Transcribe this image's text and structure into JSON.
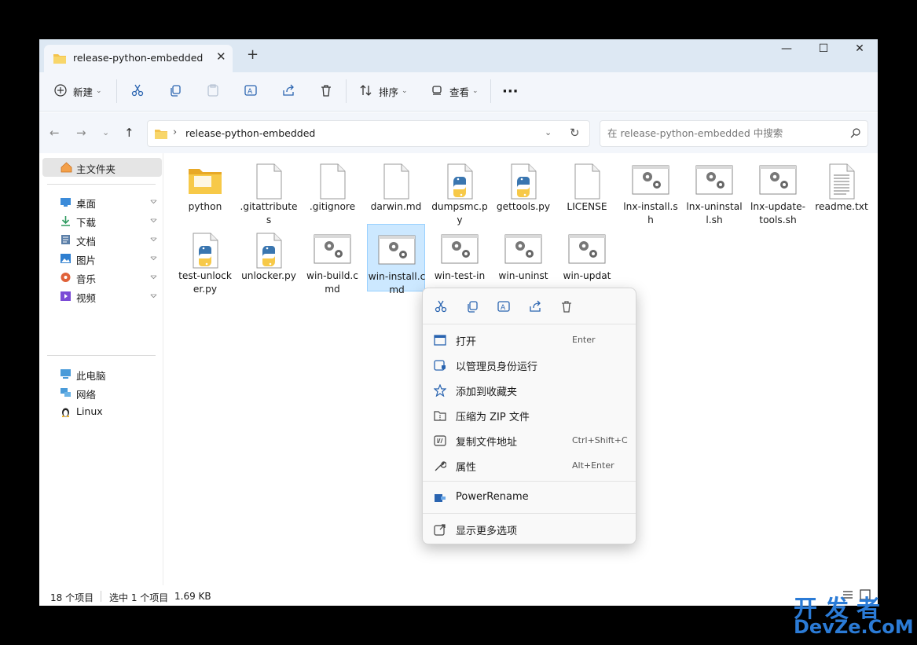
{
  "window": {
    "tab_title": "release-python-embedded",
    "close_glyph": "✕",
    "new_tab_glyph": "+",
    "min_glyph": "—",
    "max_glyph": "☐",
    "close_window_glyph": "✕"
  },
  "toolbar": {
    "new_label": "新建",
    "sort_label": "排序",
    "view_label": "查看",
    "more_label": "···",
    "icons": [
      "plus-icon",
      "cut-icon",
      "copy-icon",
      "paste-icon",
      "rename-icon",
      "share-icon",
      "delete-icon",
      "sort-icon",
      "view-icon"
    ]
  },
  "address": {
    "path": "release-python-embedded",
    "separator": "›",
    "search_placeholder": "在 release-python-embedded 中搜索"
  },
  "sidebar": {
    "home": "主文件夹",
    "quick_access": [
      {
        "label": "桌面",
        "icon": "desktop-icon",
        "color": "#3b8bd9"
      },
      {
        "label": "下载",
        "icon": "download-icon",
        "color": "#2e9a5f"
      },
      {
        "label": "文档",
        "icon": "documents-icon",
        "color": "#5b7fa8"
      },
      {
        "label": "图片",
        "icon": "pictures-icon",
        "color": "#2f7fd0"
      },
      {
        "label": "音乐",
        "icon": "music-icon",
        "color": "#e0623a"
      },
      {
        "label": "视频",
        "icon": "videos-icon",
        "color": "#7b4bd6"
      }
    ],
    "devices": [
      {
        "label": "此电脑",
        "icon": "computer-icon"
      },
      {
        "label": "网络",
        "icon": "network-icon"
      },
      {
        "label": "Linux",
        "icon": "linux-icon"
      }
    ]
  },
  "files": [
    {
      "name": "python",
      "type": "folder"
    },
    {
      "name": ".gitattributes",
      "type": "blank"
    },
    {
      "name": ".gitignore",
      "type": "blank"
    },
    {
      "name": "darwin.md",
      "type": "blank"
    },
    {
      "name": "dumpsmc.py",
      "type": "py"
    },
    {
      "name": "gettools.py",
      "type": "py"
    },
    {
      "name": "LICENSE",
      "type": "blank"
    },
    {
      "name": "lnx-install.sh",
      "type": "script"
    },
    {
      "name": "lnx-uninstall.sh",
      "type": "script"
    },
    {
      "name": "lnx-update-tools.sh",
      "type": "script"
    },
    {
      "name": "readme.txt",
      "type": "txt"
    },
    {
      "name": "test-unlocker.py",
      "type": "py"
    },
    {
      "name": "unlocker.py",
      "type": "py"
    },
    {
      "name": "win-build.cmd",
      "type": "script"
    },
    {
      "name": "win-install.cmd",
      "type": "script",
      "selected": true
    },
    {
      "name": "win-test-in",
      "type": "script"
    },
    {
      "name": "win-uninst",
      "type": "script"
    },
    {
      "name": "win-updat",
      "type": "script"
    }
  ],
  "status": {
    "count": "18 个项目",
    "selection": "选中 1 个项目",
    "size": "1.69 KB"
  },
  "context_menu": {
    "top_icons": [
      "cut-icon",
      "copy-icon",
      "rename-icon",
      "share-icon",
      "delete-icon"
    ],
    "items": [
      {
        "label": "打开",
        "accel": "Enter",
        "icon": "open-icon"
      },
      {
        "label": "以管理员身份运行",
        "accel": "",
        "icon": "shield-icon"
      },
      {
        "label": "添加到收藏夹",
        "accel": "",
        "icon": "star-icon"
      },
      {
        "label": "压缩为 ZIP 文件",
        "accel": "",
        "icon": "zip-icon"
      },
      {
        "label": "复制文件地址",
        "accel": "Ctrl+Shift+C",
        "icon": "copy-path-icon"
      },
      {
        "label": "属性",
        "accel": "Alt+Enter",
        "icon": "wrench-icon"
      },
      {
        "label": "PowerRename",
        "accel": "",
        "icon": "powerrename-icon"
      },
      {
        "label": "显示更多选项",
        "accel": "",
        "icon": "more-options-icon"
      }
    ]
  },
  "watermark": {
    "line1": "开发者",
    "line2": "DevZe.CoM"
  },
  "colors": {
    "accent": "#0067c0",
    "selection": "#cce8ff",
    "folder": "#f4c34d",
    "python_blue": "#3a76b0",
    "python_yellow": "#f7c948"
  }
}
